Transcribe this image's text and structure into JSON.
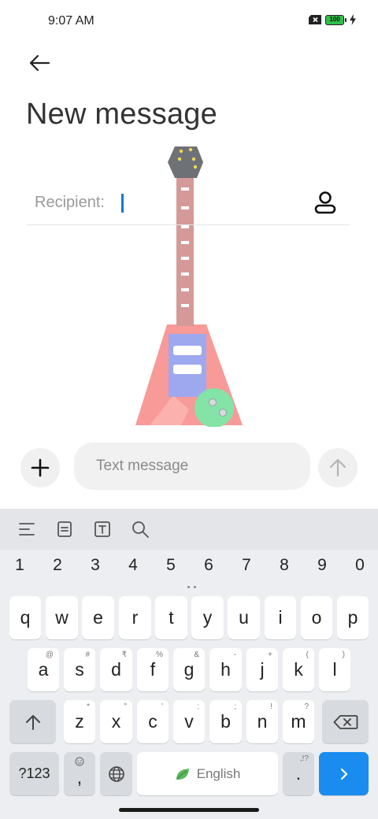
{
  "status_bar": {
    "time": "9:07 AM",
    "battery": "100",
    "icons": [
      "sim-x-icon",
      "battery-icon",
      "charging-bolt-icon"
    ]
  },
  "header": {
    "back_icon": "arrow-left-icon",
    "title": "New message"
  },
  "recipient": {
    "label": "Recipient:",
    "value": "",
    "contact_icon": "contact-person-icon"
  },
  "illustration": {
    "name": "guitar-illustration",
    "colors": {
      "head": "#6e7176",
      "neck": "#d49a98",
      "body": "#f79a98",
      "pickup": "#9ea8ee",
      "knob": "#84e3a6"
    }
  },
  "compose": {
    "attach_icon": "plus-icon",
    "placeholder": "Text message",
    "send_icon": "arrow-up-icon"
  },
  "keyboard": {
    "toolbar_icons": [
      "text-align-icon",
      "clipboard-icon",
      "text-format-icon",
      "search-icon"
    ],
    "numbers": [
      "1",
      "2",
      "3",
      "4",
      "5",
      "6",
      "7",
      "8",
      "9",
      "0"
    ],
    "row1": [
      "q",
      "w",
      "e",
      "r",
      "t",
      "y",
      "u",
      "i",
      "o",
      "p"
    ],
    "row2": [
      {
        "key": "a",
        "hint": "@"
      },
      {
        "key": "s",
        "hint": "#"
      },
      {
        "key": "d",
        "hint": "₹"
      },
      {
        "key": "f",
        "hint": "%"
      },
      {
        "key": "g",
        "hint": "&"
      },
      {
        "key": "h",
        "hint": "-"
      },
      {
        "key": "j",
        "hint": "+"
      },
      {
        "key": "k",
        "hint": "("
      },
      {
        "key": "l",
        "hint": ")"
      }
    ],
    "row3": [
      {
        "key": "z",
        "hint": "*"
      },
      {
        "key": "x",
        "hint": "\""
      },
      {
        "key": "c",
        "hint": "'"
      },
      {
        "key": "v",
        "hint": ":"
      },
      {
        "key": "b",
        "hint": ";"
      },
      {
        "key": "n",
        "hint": "!"
      },
      {
        "key": "m",
        "hint": "?"
      }
    ],
    "symbols_label": "?123",
    "comma": ",",
    "space_label": "English",
    "period": ".",
    "period_hint": ",!?",
    "accent_color": "#1a8cf0"
  }
}
